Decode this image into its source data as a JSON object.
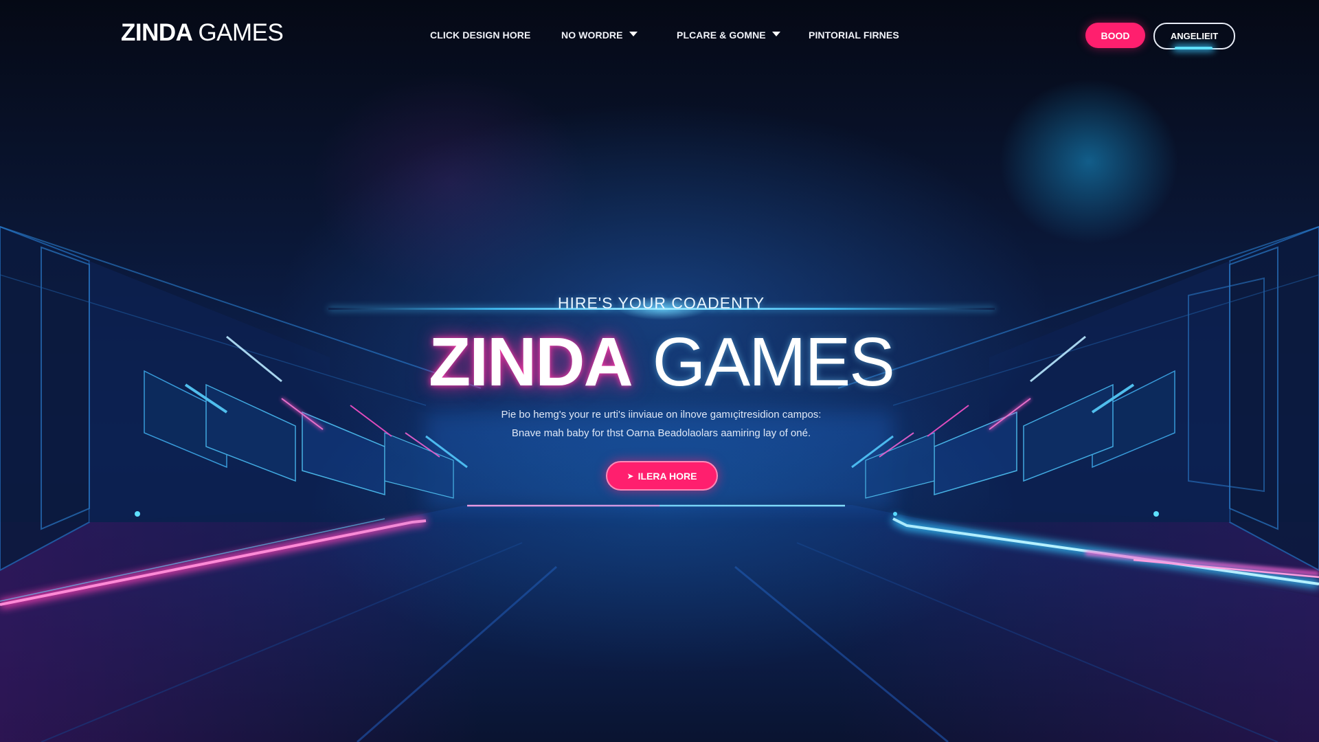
{
  "colors": {
    "accent_pink": "#ff1f6e",
    "accent_cyan": "#36c8ff",
    "background": "#070c1f"
  },
  "navbar": {
    "logo": {
      "bold": "ZINDA",
      "light": "GAMES"
    },
    "links": [
      {
        "label": "CLICK DESIGN HORE",
        "has_dropdown": false
      },
      {
        "label": "NO WORDRE",
        "has_dropdown": true
      },
      {
        "label": "PLCARE & GOMNE",
        "has_dropdown": true
      },
      {
        "label": "PINTORIAL FIRNES",
        "has_dropdown": false
      }
    ],
    "buttons": {
      "primary": "BOOD",
      "secondary": "ANGELIEIT"
    },
    "icons": {
      "dropdown": "caret-down-icon"
    }
  },
  "hero": {
    "eyebrow": "HIRE'S YOUR COADENTY",
    "title_bold": "ZINDA",
    "title_light": "GAMES",
    "description_line1": "Pie bo hemg's your re urti's iinviaue on ilnove gamıçitresidion campos:",
    "description_line2": "Bnave mah baby for thst Oarna Beadolaolars aamiring lay of oné.",
    "cta_label": "ILERA HORE",
    "cta_icon": "chevron-right-icon"
  }
}
